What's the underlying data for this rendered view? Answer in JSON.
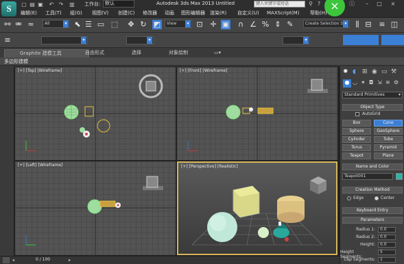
{
  "app": {
    "logo": "S",
    "title": "Autodesk 3ds Max 2013    Untitled",
    "workspace_label": "工作台:",
    "workspace_value": "默认",
    "search_placeholder": "键入关键字或短语",
    "close_glyph": "×"
  },
  "menu": [
    "编辑(E)",
    "工具(T)",
    "组(G)",
    "视图(V)",
    "创建(C)",
    "修改器",
    "动画",
    "图形编辑器",
    "渲染(R)",
    "自定义(U)",
    "MAXScript(M)",
    "帮助(H)"
  ],
  "toolbar": {
    "filter_value": "All",
    "refcoord_value": "View",
    "selection_set_placeholder": "Create Selection Se"
  },
  "ribbon": {
    "tabs": [
      "Graphite 建模工具",
      "自由形式",
      "选择",
      "对象绘制"
    ]
  },
  "subbar": {
    "label": "多边形建模"
  },
  "viewports": {
    "top_label": "[+] [Top] [Wireframe]",
    "front_label": "[+] [Front] [Wireframe]",
    "left_label": "[+] [Left] [Wireframe]",
    "persp_label": "[+] [Perspective] [Realistic]"
  },
  "command_panel": {
    "category": "Standard Primitives",
    "object_type_title": "Object Type",
    "autogrid_label": "AutoGrid",
    "buttons": [
      "Box",
      "Cone",
      "Sphere",
      "GeoSphere",
      "Cylinder",
      "Tube",
      "Torus",
      "Pyramid",
      "Teapot",
      "Plane"
    ],
    "active_button": "Cone",
    "name_color_title": "Name and Color",
    "object_name": "Teapot001",
    "creation_method_title": "Creation Method",
    "edge_label": "Edge",
    "center_label": "Center",
    "keyboard_entry_title": "Keyboard Entry",
    "parameters_title": "Parameters",
    "params": [
      {
        "label": "Radius 1:",
        "value": "0.0"
      },
      {
        "label": "Radius 2:",
        "value": "0.0"
      },
      {
        "label": "Height:",
        "value": "0.0"
      },
      {
        "label": "Height Segments:",
        "value": "5"
      },
      {
        "label": "Cap Segments:",
        "value": "1"
      }
    ]
  },
  "status": {
    "frame_counter": "0 / 100"
  },
  "colors": {
    "accent_blue": "#3c7fd6",
    "close_green": "#3cc63c",
    "persp_border": "#d6b85a",
    "name_swatch": "#29b6a8"
  }
}
